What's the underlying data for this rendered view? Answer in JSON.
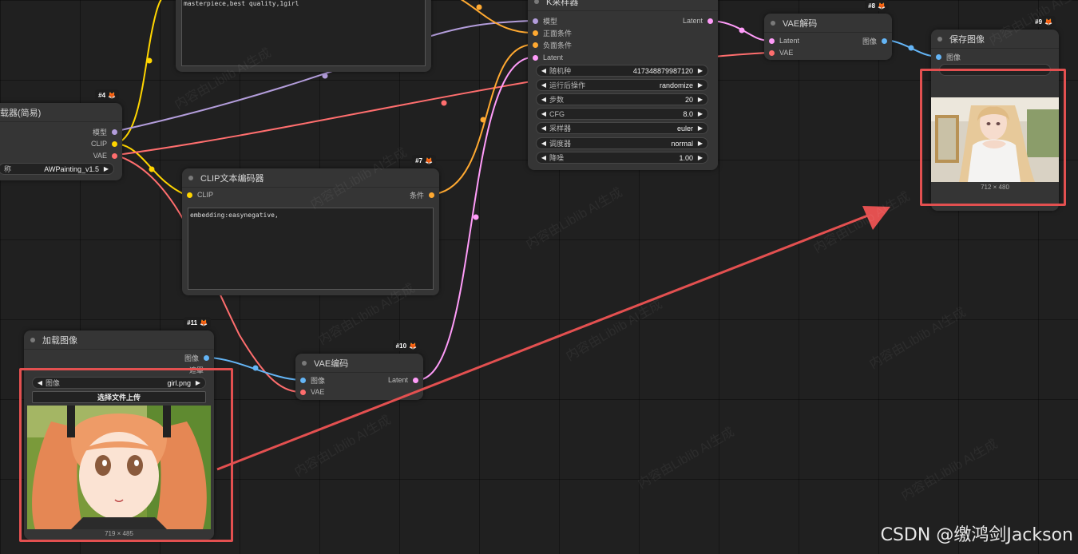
{
  "nodes": {
    "checkpoint": {
      "badge": "#4",
      "title": "载器(简易)",
      "outputs": [
        "模型",
        "CLIP",
        "VAE"
      ],
      "widget_label": "称",
      "widget_value": "AWPainting_v1.5"
    },
    "positive_prompt": {
      "text": "masterpiece,best quality,1girl"
    },
    "negative_prompt": {
      "badge": "#7",
      "title": "CLIP文本编码器",
      "input": "CLIP",
      "output": "条件",
      "text": "embedding:easynegative,"
    },
    "ksampler": {
      "title": "K采样器",
      "inputs": [
        "模型",
        "正面条件",
        "负面条件",
        "Latent"
      ],
      "output": "Latent",
      "widgets": [
        {
          "label": "随机种",
          "value": "417348879987120"
        },
        {
          "label": "运行后操作",
          "value": "randomize"
        },
        {
          "label": "步数",
          "value": "20"
        },
        {
          "label": "CFG",
          "value": "8.0"
        },
        {
          "label": "采样器",
          "value": "euler"
        },
        {
          "label": "调度器",
          "value": "normal"
        },
        {
          "label": "降噪",
          "value": "1.00"
        }
      ]
    },
    "vae_decode": {
      "badge": "#8",
      "title": "VAE解码",
      "inputs": [
        "Latent",
        "VAE"
      ],
      "output": "图像"
    },
    "save_image": {
      "badge": "#9",
      "title": "保存图像",
      "input": "图像",
      "image_size": "712 × 480"
    },
    "load_image": {
      "badge": "#11",
      "title": "加载图像",
      "outputs": [
        "图像",
        "遮罩"
      ],
      "widget_label": "图像",
      "widget_value": "girl.png",
      "upload_label": "选择文件上传",
      "image_size": "719 × 485"
    },
    "vae_encode": {
      "badge": "#10",
      "title": "VAE编码",
      "inputs": [
        "图像",
        "VAE"
      ],
      "output": "Latent"
    }
  },
  "watermark": "内容由Liblib AI生成",
  "credit": "CSDN @缴鸿剑Jackson",
  "colors": {
    "clip": "#ffd500",
    "model": "#b39ddb",
    "vae": "#ff6e6e",
    "conditioning": "#ffa931",
    "latent": "#ff9cf9",
    "image": "#64b5f6",
    "highlight": "#e35050",
    "canvas": "#202020",
    "node": "#353535"
  }
}
